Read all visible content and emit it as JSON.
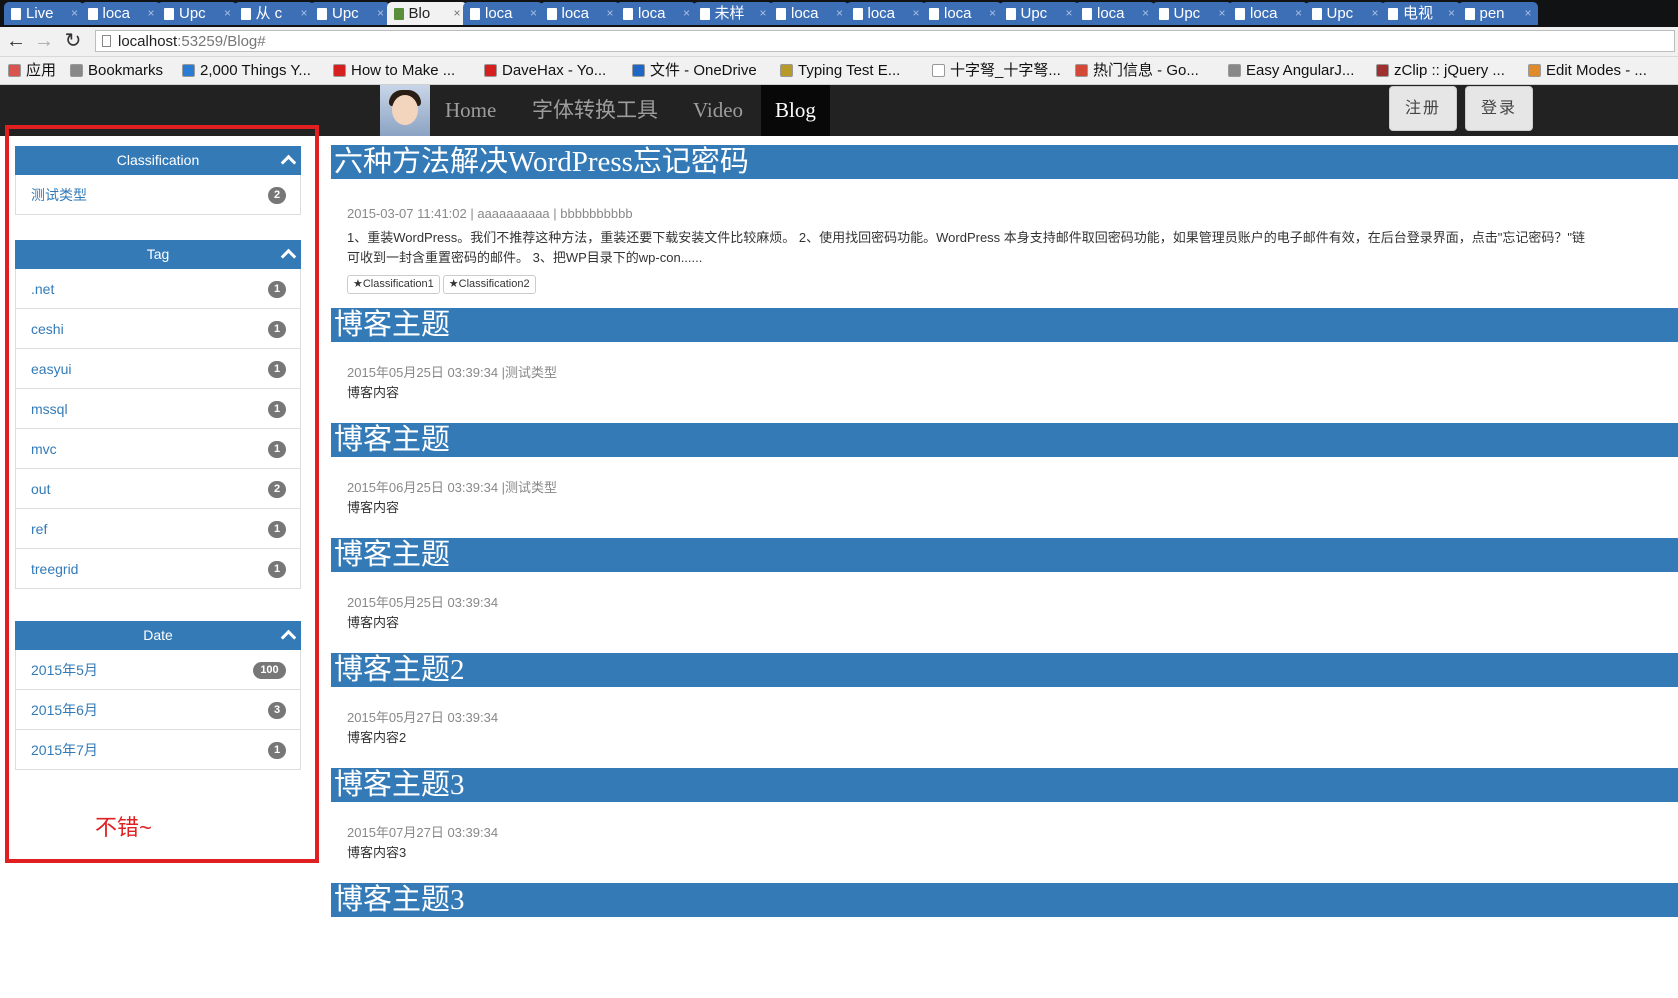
{
  "browser": {
    "tabs": [
      {
        "label": "Live",
        "active": false
      },
      {
        "label": "loca",
        "active": false
      },
      {
        "label": "Upc",
        "active": false
      },
      {
        "label": "从 c",
        "active": false
      },
      {
        "label": "Upc",
        "active": false
      },
      {
        "label": "Blo",
        "active": true
      },
      {
        "label": "loca",
        "active": false
      },
      {
        "label": "loca",
        "active": false
      },
      {
        "label": "loca",
        "active": false
      },
      {
        "label": "未样",
        "active": false
      },
      {
        "label": "loca",
        "active": false
      },
      {
        "label": "loca",
        "active": false
      },
      {
        "label": "loca",
        "active": false
      },
      {
        "label": "Upc",
        "active": false
      },
      {
        "label": "loca",
        "active": false
      },
      {
        "label": "Upc",
        "active": false
      },
      {
        "label": "loca",
        "active": false
      },
      {
        "label": "Upc",
        "active": false
      },
      {
        "label": "电视",
        "active": false
      },
      {
        "label": "pen",
        "active": false
      }
    ],
    "url_host": "localhost",
    "url_rest": ":53259/Blog#",
    "bookmarks": [
      {
        "label": "应用",
        "icon": "apps-grid-icon",
        "color": "#d9534f"
      },
      {
        "label": "Bookmarks",
        "icon": "star-icon",
        "color": "#888888"
      },
      {
        "label": "2,000 Things Y...",
        "icon": "wordpress-icon",
        "color": "#2a7bd3"
      },
      {
        "label": "How to Make ...",
        "icon": "youtube-icon",
        "color": "#d62020"
      },
      {
        "label": "DaveHax - Yo...",
        "icon": "youtube-icon",
        "color": "#d62020"
      },
      {
        "label": "文件 - OneDrive",
        "icon": "onedrive-icon",
        "color": "#1f67c7"
      },
      {
        "label": "Typing Test E...",
        "icon": "leaf-icon",
        "color": "#b89a2a"
      },
      {
        "label": "十字弩_十字弩...",
        "icon": "page-icon",
        "color": "#ffffff"
      },
      {
        "label": "热门信息 - Go...",
        "icon": "googleplus-icon",
        "color": "#d34836"
      },
      {
        "label": "Easy AngularJ...",
        "icon": "code-icon",
        "color": "#888888"
      },
      {
        "label": "zClip :: jQuery ...",
        "icon": "clip-icon",
        "color": "#a03030"
      },
      {
        "label": "Edit Modes - ...",
        "icon": "edit-icon",
        "color": "#e08a2a"
      }
    ]
  },
  "site": {
    "nav": [
      {
        "label": "Home",
        "active": false
      },
      {
        "label": "字体转换工具",
        "active": false
      },
      {
        "label": "Video",
        "active": false
      },
      {
        "label": "Blog",
        "active": true
      }
    ],
    "register_label": "注册",
    "login_label": "登录"
  },
  "sidebar": {
    "classification": {
      "title": "Classification",
      "items": [
        {
          "label": "测试类型",
          "count": "2"
        }
      ]
    },
    "tag": {
      "title": "Tag",
      "items": [
        {
          "label": ".net",
          "count": "1"
        },
        {
          "label": "ceshi",
          "count": "1"
        },
        {
          "label": "easyui",
          "count": "1"
        },
        {
          "label": "mssql",
          "count": "1"
        },
        {
          "label": "mvc",
          "count": "1"
        },
        {
          "label": "out",
          "count": "2"
        },
        {
          "label": "ref",
          "count": "1"
        },
        {
          "label": "treegrid",
          "count": "1"
        }
      ]
    },
    "date": {
      "title": "Date",
      "items": [
        {
          "label": "2015年5月",
          "count": "100"
        },
        {
          "label": "2015年6月",
          "count": "3"
        },
        {
          "label": "2015年7月",
          "count": "1"
        }
      ]
    },
    "note": "不错~"
  },
  "posts": [
    {
      "title": "六种方法解决WordPress忘记密码",
      "meta": "2015-03-07 11:41:02 | aaaaaaaaaa | bbbbbbbbbb",
      "body_line1": "1、重装WordPress。我们不推荐这种方法，重装还要下载安装文件比较麻烦。 2、使用找回密码功能。WordPress 本身支持邮件取回密码功能，如果管理员账户的电子邮件有效，在后台登录界面，点击\"忘记密码？\"链",
      "body_line2": "可收到一封含重置密码的邮件。 3、把WP目录下的wp-con......",
      "tags": [
        "★Classification1",
        "★Classification2"
      ]
    },
    {
      "title": "博客主题",
      "meta": "2015年05月25日 03:39:34 |测试类型",
      "body": "博客内容"
    },
    {
      "title": "博客主题",
      "meta": "2015年06月25日 03:39:34 |测试类型",
      "body": "博客内容"
    },
    {
      "title": "博客主题",
      "meta": "2015年05月25日 03:39:34",
      "body": "博客内容"
    },
    {
      "title": "博客主题2",
      "meta": "2015年05月27日 03:39:34",
      "body": "博客内容2"
    },
    {
      "title": "博客主题3",
      "meta": "2015年07月27日 03:39:34",
      "body": "博客内容3"
    },
    {
      "title": "博客主题3"
    }
  ],
  "colors": {
    "accent": "#337ab7",
    "frame": "#e02020",
    "navbar": "#222222"
  }
}
